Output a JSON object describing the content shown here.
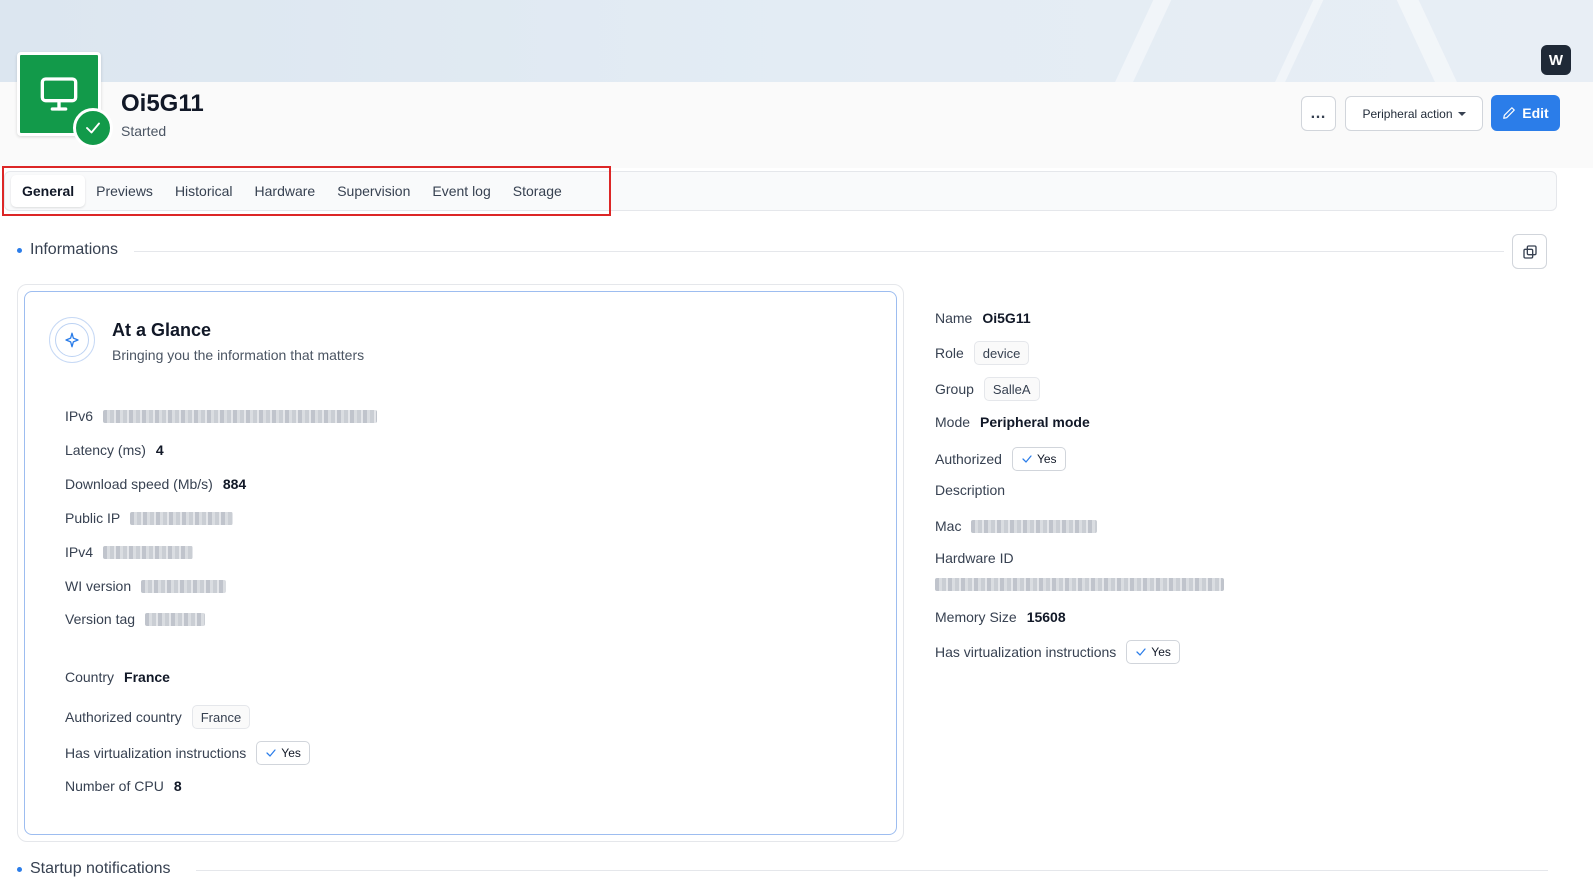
{
  "device": {
    "name": "Oi5G11",
    "status": "Started",
    "icon": "monitor-icon",
    "status_icon": "check-icon",
    "color": "#129a4a"
  },
  "header_actions": {
    "more_label": "…",
    "peripheral_action_label": "Peripheral action",
    "edit_label": "Edit",
    "accent_color": "#2b7de9"
  },
  "tabs": [
    {
      "label": "General",
      "active": true
    },
    {
      "label": "Previews",
      "active": false
    },
    {
      "label": "Historical",
      "active": false
    },
    {
      "label": "Hardware",
      "active": false
    },
    {
      "label": "Supervision",
      "active": false
    },
    {
      "label": "Event log",
      "active": false
    },
    {
      "label": "Storage",
      "active": false
    }
  ],
  "informations": {
    "title": "Informations",
    "glance": {
      "title": "At a Glance",
      "subtitle": "Bringing you the information that matters",
      "rows": {
        "ipv6": {
          "label": "IPv6",
          "value": "[redacted]"
        },
        "latency": {
          "label": "Latency (ms)",
          "value": "4"
        },
        "download": {
          "label": "Download speed (Mb/s)",
          "value": "884"
        },
        "public_ip": {
          "label": "Public IP",
          "value": "[redacted]"
        },
        "ipv4": {
          "label": "IPv4",
          "value": "[redacted]"
        },
        "wi_version": {
          "label": "WI version",
          "value": "[redacted]"
        },
        "version_tag": {
          "label": "Version tag",
          "value": "[redacted]"
        },
        "country": {
          "label": "Country",
          "value": "France"
        },
        "authorized_country": {
          "label": "Authorized country",
          "value": "France"
        },
        "virtualization": {
          "label": "Has virtualization instructions",
          "value": "Yes"
        },
        "cpu": {
          "label": "Number of CPU",
          "value": "8"
        }
      }
    },
    "details": {
      "name": {
        "label": "Name",
        "value": "Oi5G11"
      },
      "role": {
        "label": "Role",
        "value": "device"
      },
      "group": {
        "label": "Group",
        "value": "SalleA"
      },
      "mode": {
        "label": "Mode",
        "value": "Peripheral mode"
      },
      "authorized": {
        "label": "Authorized",
        "value": "Yes"
      },
      "description": {
        "label": "Description",
        "value": ""
      },
      "mac": {
        "label": "Mac",
        "value": "[redacted]"
      },
      "hardware_id": {
        "label": "Hardware ID",
        "value": "[redacted]"
      },
      "memory": {
        "label": "Memory Size",
        "value": "15608"
      },
      "virtualization": {
        "label": "Has virtualization instructions",
        "value": "Yes"
      }
    }
  },
  "startup_notifications": {
    "title": "Startup notifications"
  }
}
